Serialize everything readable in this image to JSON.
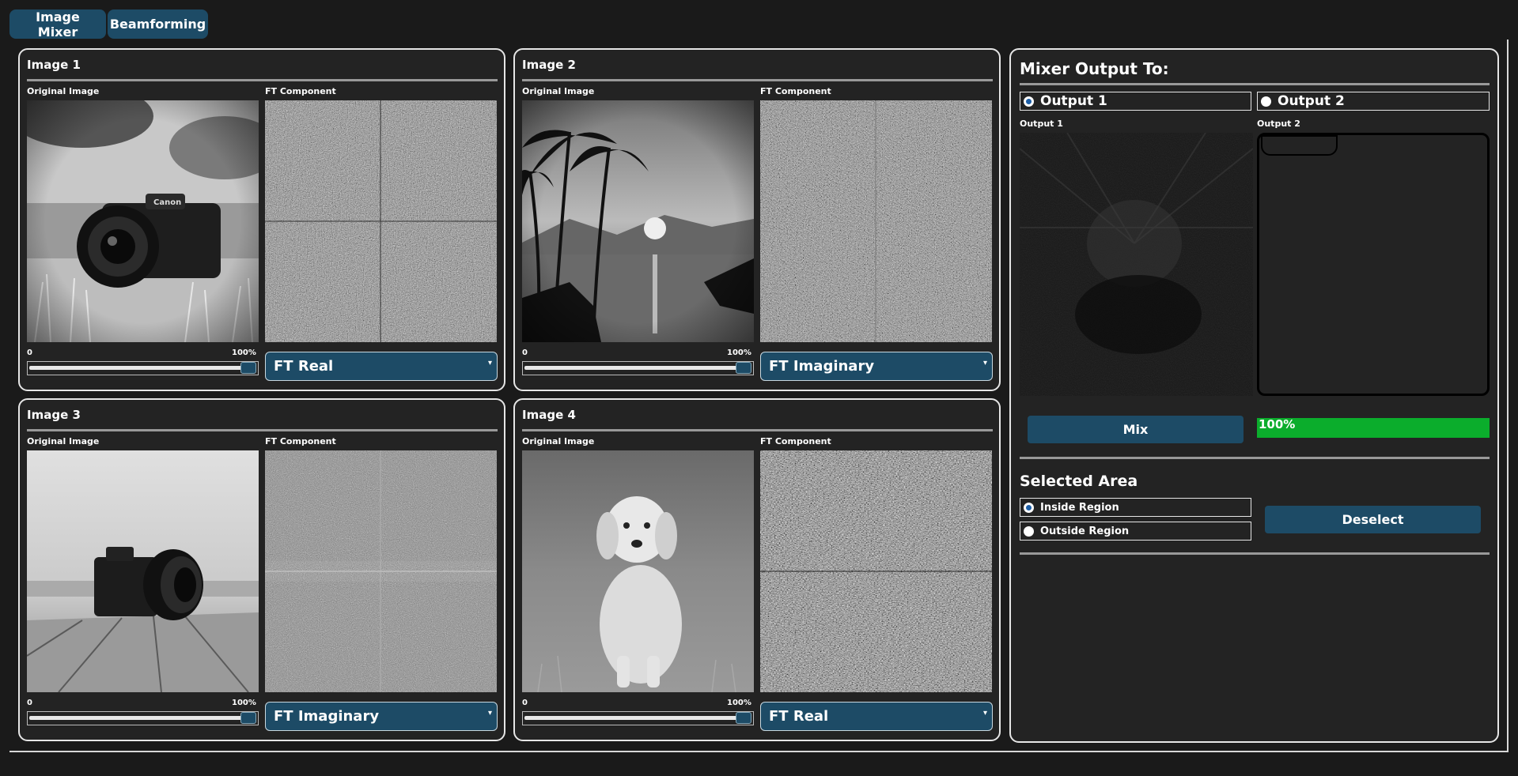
{
  "tabs": [
    {
      "label": "Image Mixer"
    },
    {
      "label": "Beamforming"
    }
  ],
  "panels": [
    {
      "title": "Image 1",
      "original_label": "Original Image",
      "ft_label": "FT Component",
      "slider_min": "0",
      "slider_max": "100%",
      "weight": 1.0,
      "component": "FT Real",
      "subject": "camera in grass"
    },
    {
      "title": "Image 2",
      "original_label": "Original Image",
      "ft_label": "FT Component",
      "slider_min": "0",
      "slider_max": "100%",
      "weight": 1.0,
      "component": "FT Imaginary",
      "subject": "palm trees at sunset"
    },
    {
      "title": "Image 3",
      "original_label": "Original Image",
      "ft_label": "FT Component",
      "slider_min": "0",
      "slider_max": "100%",
      "weight": 1.0,
      "component": "FT Imaginary",
      "subject": "camera on wooden floor"
    },
    {
      "title": "Image 4",
      "original_label": "Original Image",
      "ft_label": "FT Component",
      "slider_min": "0",
      "slider_max": "100%",
      "weight": 1.0,
      "component": "FT Real",
      "subject": "puppy on grass"
    }
  ],
  "mixer": {
    "title": "Mixer Output To:",
    "output1_radio": "Output 1",
    "output2_radio": "Output 2",
    "selected_output": "Output 1",
    "output1_label": "Output 1",
    "output2_label": "Output 2",
    "mix_button": "Mix",
    "progress_text": "100%",
    "progress": 1.0
  },
  "selected_area": {
    "title": "Selected Area",
    "inside": "Inside Region",
    "outside": "Outside Region",
    "selected": "Inside Region",
    "deselect_button": "Deselect"
  },
  "colors": {
    "accent": "#1d4b66",
    "progress": "#0bad2c",
    "background": "#1a1a1a",
    "panel": "#232323"
  }
}
